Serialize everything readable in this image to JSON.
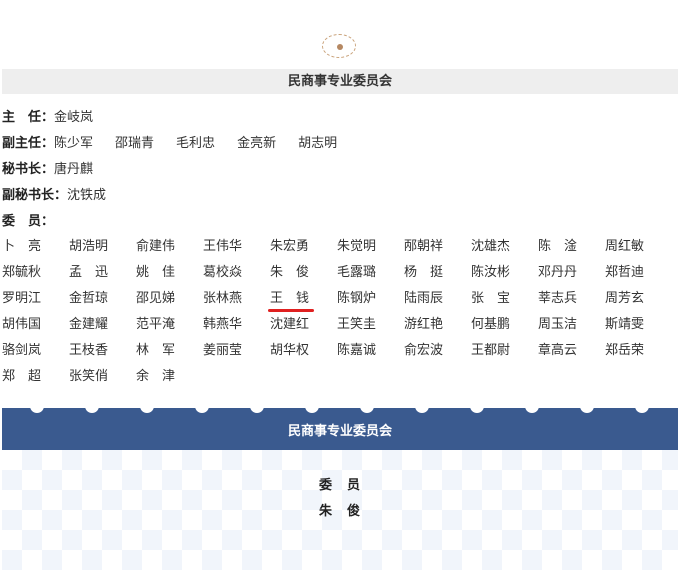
{
  "section": {
    "title": "民商事专业委员会"
  },
  "officers": [
    {
      "role": "主　任：",
      "names": [
        "金岐岚"
      ]
    },
    {
      "role": "副主任：",
      "names": [
        "陈少军",
        "邵瑞青",
        "毛利忠",
        "金亮新",
        "胡志明"
      ]
    },
    {
      "role": "秘书长：",
      "names": [
        "唐丹麒"
      ]
    },
    {
      "role": "副秘书长：",
      "names": [
        "沈铁成"
      ]
    },
    {
      "role": "委　员：",
      "names": []
    }
  ],
  "members": [
    "卜　亮",
    "胡浩明",
    "俞建伟",
    "王伟华",
    "朱宏勇",
    "朱觉明",
    "邴朝祥",
    "沈雄杰",
    "陈　淦",
    "周红敏",
    "郑毓秋",
    "孟　迅",
    "姚　佳",
    "葛校焱",
    "朱　俊",
    "毛露璐",
    "杨　挺",
    "陈汝彬",
    "邓丹丹",
    "郑哲迪",
    "罗明江",
    "金哲琼",
    "邵见娣",
    "张林燕",
    "王　钱",
    "陈钢炉",
    "陆雨辰",
    "张　宝",
    "莘志兵",
    "周芳玄",
    "胡伟国",
    "金建耀",
    "范平淹",
    "韩燕华",
    "沈建红",
    "王笑圭",
    "游红艳",
    "何基鹏",
    "周玉洁",
    "斯靖雯",
    "骆剑岚",
    "王枝香",
    "林　军",
    "姜丽莹",
    "胡华权",
    "陈嘉诚",
    "俞宏波",
    "王都尉",
    "章高云",
    "郑岳荣",
    "郑　超",
    "张笑俏",
    "余　津"
  ],
  "highlighted_member": "朱　俊",
  "banner": {
    "title": "民商事专业委员会"
  },
  "card": {
    "role": "委　员",
    "name": "朱　俊"
  },
  "colors": {
    "banner": "#3a5a8f",
    "highlight_underline": "#e02020",
    "section_bar": "#eeeeee"
  }
}
